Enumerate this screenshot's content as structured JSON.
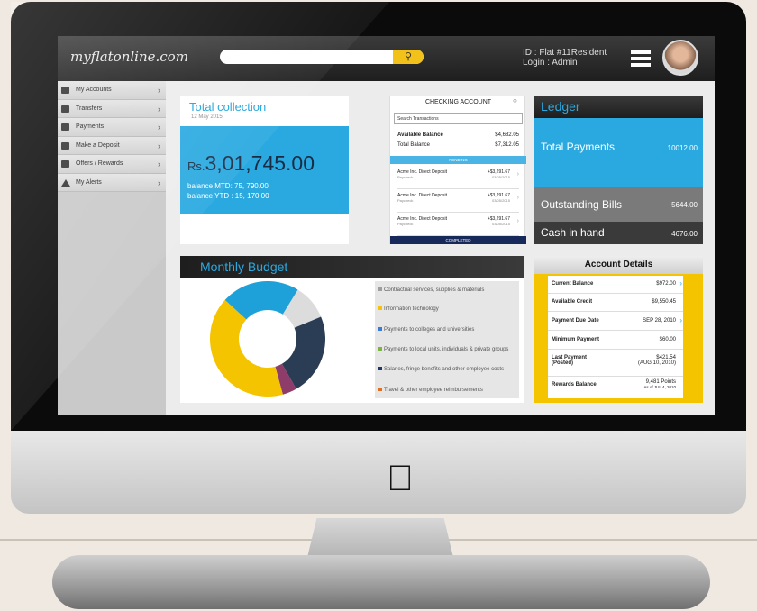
{
  "app": {
    "brand": "myflatonline.com"
  },
  "header": {
    "search": {
      "placeholder": "",
      "button_icon": "search-icon"
    },
    "user": {
      "id": "ID  : Flat #11Resident",
      "login": "Login : Admin"
    }
  },
  "sidebar": {
    "items": [
      {
        "label": "My Accounts",
        "icon": "account-icon"
      },
      {
        "label": "Transfers",
        "icon": "transfer-icon"
      },
      {
        "label": "Payments",
        "icon": "payments-icon"
      },
      {
        "label": "Make a Deposit",
        "icon": "deposit-icon"
      },
      {
        "label": "Offers / Rewards",
        "icon": "gift-icon"
      },
      {
        "label": "My Alerts",
        "icon": "warning-icon"
      }
    ]
  },
  "total_collection": {
    "title": "Total collection",
    "date": "12 May 2015",
    "currency": "Rs.",
    "amount_main": "3,01,745.",
    "amount_dec": "00",
    "mtd": "balance MTD: 75, 790.00",
    "ytd": "balance YTD : 15, 170.00"
  },
  "checking": {
    "title": "CHECKING ACCOUNT",
    "search_placeholder": "Search Transactions",
    "available_label": "Available Balance",
    "available_value": "$4,682.05",
    "total_label": "Total Balance",
    "total_value": "$7,312.05",
    "pending": "PENDING",
    "completed": "COMPLETED",
    "transactions": [
      {
        "name": "Acme Inc. Direct Deposit",
        "sub": "Paycheck",
        "amount": "+$3,291.67",
        "date": "03/05/2015"
      },
      {
        "name": "Acme Inc. Direct Deposit",
        "sub": "Paycheck",
        "amount": "+$3,291.67",
        "date": "03/05/2015"
      },
      {
        "name": "Acme Inc. Direct Deposit",
        "sub": "Paycheck",
        "amount": "+$3,291.67",
        "date": "03/05/2015"
      }
    ]
  },
  "ledger": {
    "title": "Ledger",
    "rows": [
      {
        "label": "Total Payments",
        "value": "10012.00"
      },
      {
        "label": "Outstanding Bills",
        "value": "5644.00"
      },
      {
        "label": "Cash in hand",
        "value": "4676.00"
      }
    ]
  },
  "budget": {
    "title": "Monthly Budget",
    "legend": [
      {
        "label": "Contractual services, supplies & materials",
        "color": "#9e9e9e"
      },
      {
        "label": "Information technology",
        "color": "#f5c400"
      },
      {
        "label": "Payments to colleges and universities",
        "color": "#3a7bd5"
      },
      {
        "label": "Payments to local units, individuals & private groups",
        "color": "#7cb342"
      },
      {
        "label": "Salaries, fringe benefits and other employee costs",
        "color": "#1b3a6b"
      },
      {
        "label": "Travel & other employee reimbursements",
        "color": "#e07020"
      }
    ]
  },
  "chart_data": {
    "type": "pie",
    "donut": true,
    "slices": [
      {
        "color": "#dcdcdc",
        "value": 10
      },
      {
        "color": "#2b3d55",
        "value": 23
      },
      {
        "color": "#8e3c6a",
        "value": 4
      },
      {
        "color": "#f5c400",
        "value": 41
      },
      {
        "color": "#1ea0d8",
        "value": 22
      }
    ]
  },
  "account_details": {
    "title": "Account Details",
    "rows": [
      {
        "label": "Current Balance",
        "value": "$972.00",
        "sub": "",
        "arrow": true
      },
      {
        "label": "Available Credit",
        "value": "$9,550.45",
        "sub": "",
        "arrow": false
      },
      {
        "label": "Payment Due Date",
        "value": "SEP 28, 2010",
        "sub": "",
        "arrow": true
      },
      {
        "label": "Minimum Payment",
        "value": "$60.00",
        "sub": "",
        "arrow": false
      },
      {
        "label": "Last Payment (Posted)",
        "value": "$421.54",
        "sub": "(AUG 10, 2010)",
        "arrow": false
      },
      {
        "label": "Rewards Balance",
        "value": "9,481 Points",
        "sub": "As of JUL 4, 2010",
        "arrow": false
      }
    ]
  }
}
